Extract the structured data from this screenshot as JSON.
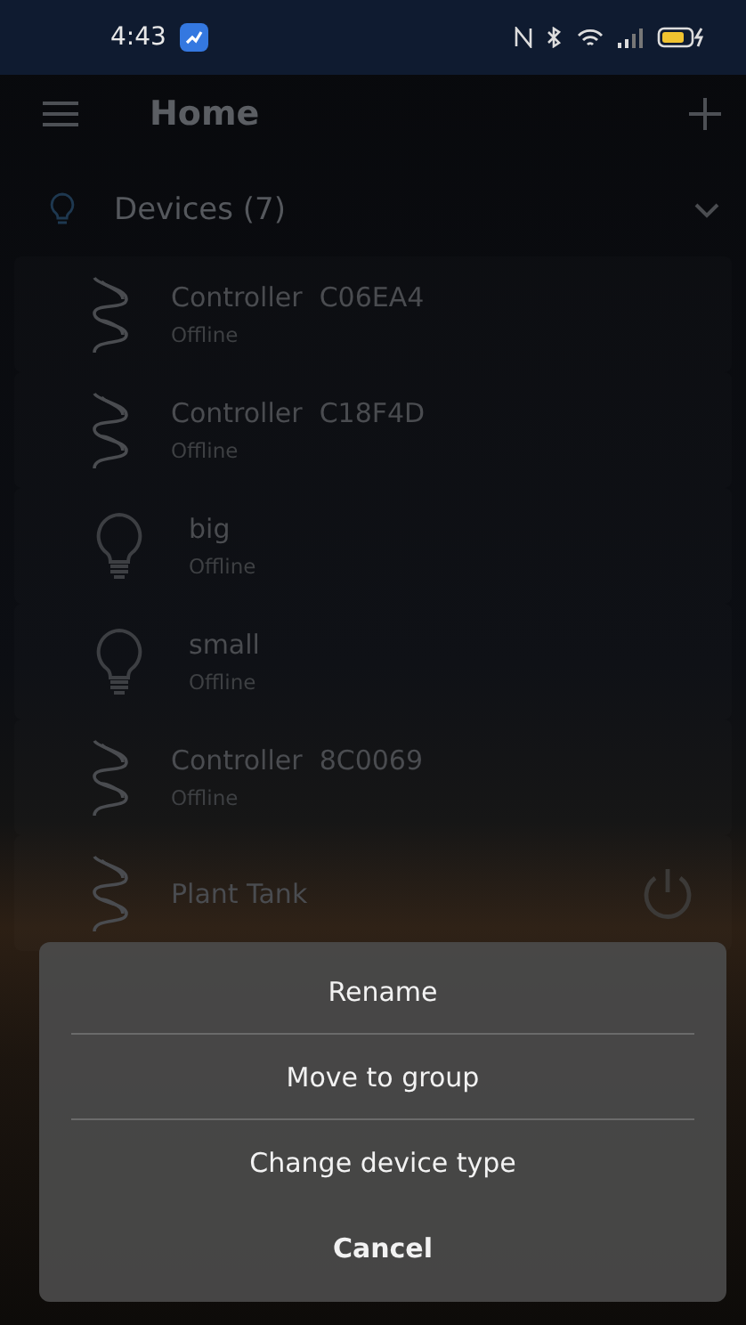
{
  "status_bar": {
    "time": "4:43"
  },
  "app_bar": {
    "title": "Home"
  },
  "devices_section": {
    "title": "Devices (7)",
    "expanded": true,
    "devices": [
      {
        "kind": "strip",
        "name": "Controller  C06EA4",
        "status": "Offline",
        "power_button": false
      },
      {
        "kind": "strip",
        "name": "Controller  C18F4D",
        "status": "Offline",
        "power_button": false
      },
      {
        "kind": "bulb",
        "name": "big",
        "status": "Offline",
        "power_button": false
      },
      {
        "kind": "bulb",
        "name": "small",
        "status": "Offline",
        "power_button": false
      },
      {
        "kind": "strip",
        "name": "Controller  8C0069",
        "status": "Offline",
        "power_button": false
      },
      {
        "kind": "strip",
        "name": "Plant Tank",
        "power_button": true
      }
    ]
  },
  "action_sheet": {
    "items": [
      {
        "kind": "action",
        "label": "Rename"
      },
      {
        "kind": "action",
        "label": "Move to group"
      },
      {
        "kind": "action",
        "label": "Change device type"
      },
      {
        "kind": "cancel",
        "label": "Cancel"
      }
    ]
  }
}
